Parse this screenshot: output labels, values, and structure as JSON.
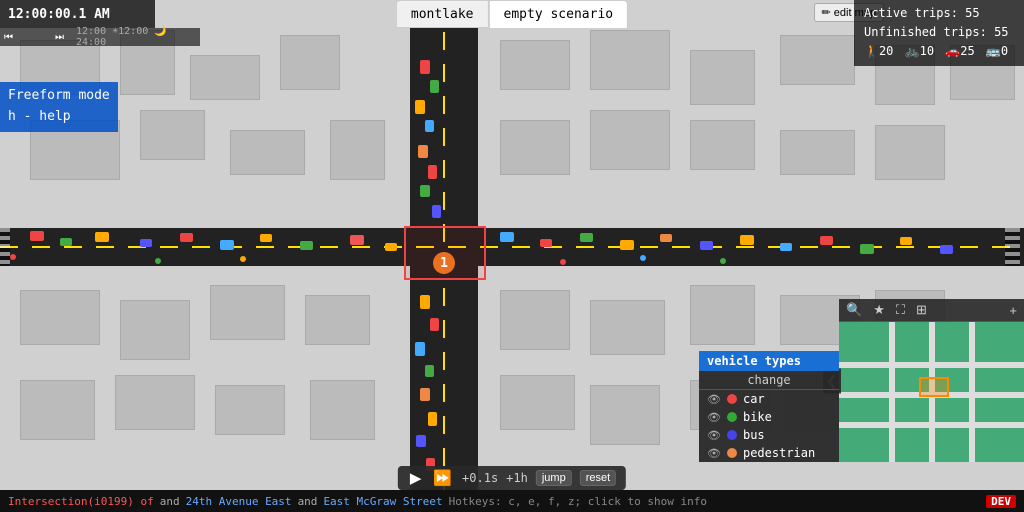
{
  "header": {
    "time": "12:00:00.1 AM",
    "tabs": [
      {
        "label": "montlake",
        "active": false
      },
      {
        "label": "empty scenario",
        "active": true
      }
    ],
    "edit_map_label": "✏ edit map"
  },
  "stats": {
    "active_trips_label": "Active trips:",
    "active_trips_value": "55",
    "unfinished_trips_label": "Unfinished trips:",
    "unfinished_trips_value": "55",
    "walkers": "20",
    "bikers": "10",
    "cars": "25",
    "buses": "0"
  },
  "left_panel": {
    "mode": "Freeform mode",
    "hint": "h - help"
  },
  "vehicle_types": {
    "title": "vehicle types",
    "change_label": "change",
    "items": [
      {
        "label": "car",
        "color": "#e44"
      },
      {
        "label": "bike",
        "color": "#3a3"
      },
      {
        "label": "bus",
        "color": "#44e"
      },
      {
        "label": "pedestrian",
        "color": "#e84"
      }
    ]
  },
  "playback": {
    "play_icon": "▶",
    "fast_icon": "⏩",
    "step_label": "+0.1s",
    "hour_label": "+1h",
    "jump_label": "jump",
    "reset_label": "reset"
  },
  "bottom_bar": {
    "intersection_prefix": "Intersection(",
    "intersection_id": "i0199",
    "intersection_suffix": ") of",
    "street1": "24th Avenue East",
    "and": "and",
    "street2": "East McGraw Street",
    "hotkeys_label": "  Hotkeys: c, e, f, z; click to show info",
    "dev_badge": "DEV"
  },
  "speed_segments": 6,
  "active_speed_segments": 2,
  "badge_number": "1",
  "minimap": {
    "zoom_icon": "🔍",
    "star_icon": "★",
    "expand_icon": "⛶",
    "layer_icon": "⊞",
    "plus_icon": "+",
    "arrow_left": "❮"
  }
}
